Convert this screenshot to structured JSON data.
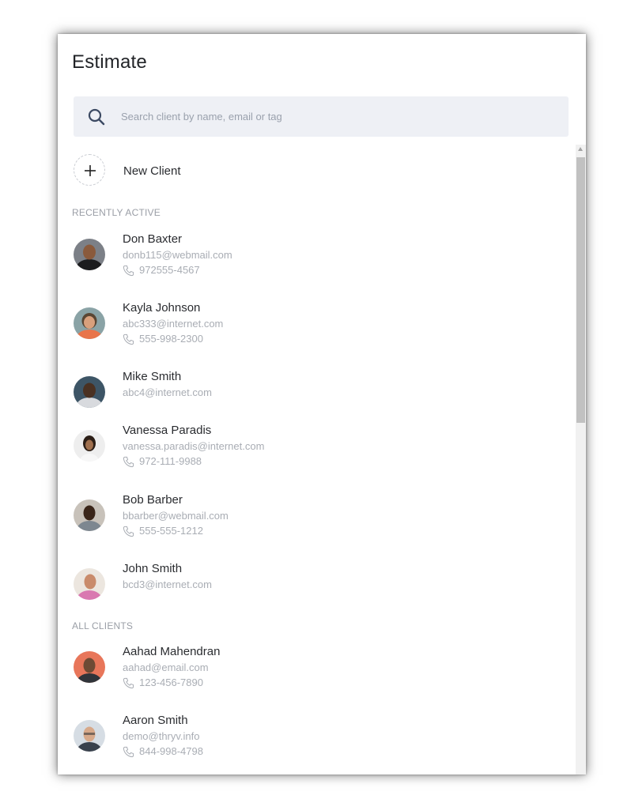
{
  "header": {
    "title": "Estimate"
  },
  "search": {
    "placeholder": "Search client by name, email or tag",
    "value": ""
  },
  "new_client": {
    "label": "New Client"
  },
  "sections": {
    "recent": "RECENTLY ACTIVE",
    "all": "ALL CLIENTS"
  },
  "recent_clients": [
    {
      "name": "Don Baxter",
      "email": "donb115@webmail.com",
      "phone": "972555-4567"
    },
    {
      "name": "Kayla Johnson",
      "email": "abc333@internet.com",
      "phone": "555-998-2300"
    },
    {
      "name": "Mike Smith",
      "email": "abc4@internet.com",
      "phone": ""
    },
    {
      "name": "Vanessa Paradis",
      "email": "vanessa.paradis@internet.com",
      "phone": "972-111-9988"
    },
    {
      "name": "Bob Barber",
      "email": "bbarber@webmail.com",
      "phone": "555-555-1212"
    },
    {
      "name": "John Smith",
      "email": "bcd3@internet.com",
      "phone": ""
    }
  ],
  "all_clients": [
    {
      "name": "Aahad Mahendran",
      "email": "aahad@email.com",
      "phone": "123-456-7890"
    },
    {
      "name": "Aaron Smith",
      "email": "demo@thryv.info",
      "phone": "844-998-4798"
    }
  ],
  "colors": {
    "search_bg": "#eef0f5",
    "text_primary": "#2a2c30",
    "text_secondary": "#a9adb4",
    "search_icon": "#3c4a63"
  },
  "icons": {
    "search": "search-icon",
    "plus": "plus-icon",
    "phone": "phone-icon"
  }
}
